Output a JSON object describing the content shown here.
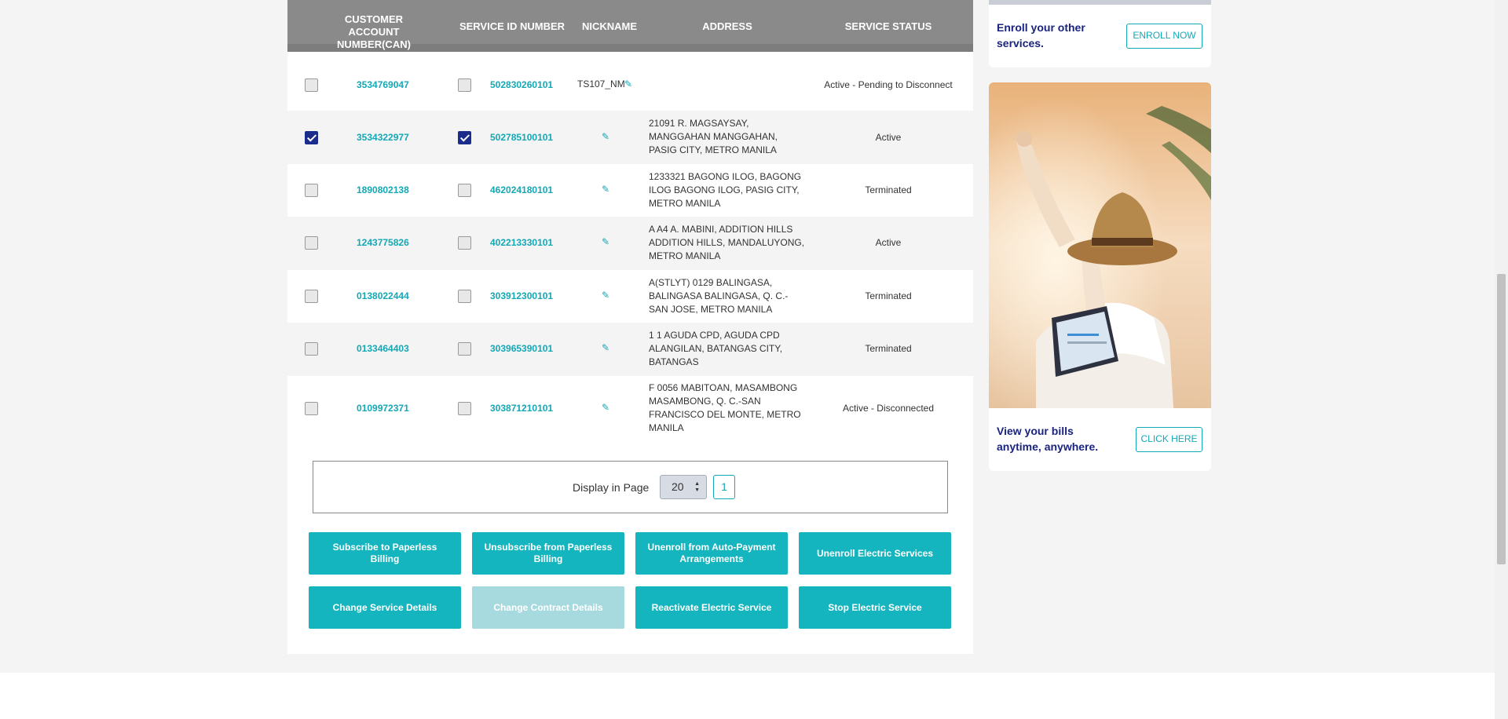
{
  "table": {
    "headers": {
      "can": "CUSTOMER ACCOUNT NUMBER(CAN)",
      "sid": "SERVICE ID NUMBER",
      "nickname": "NICKNAME",
      "address": "ADDRESS",
      "status": "SERVICE STATUS"
    },
    "rows": [
      {
        "can": "3534769047",
        "sid": "502830260101",
        "nickname": "TS107_NM",
        "address": "",
        "status": "Active - Pending to Disconnect",
        "checked": false
      },
      {
        "can": "3534322977",
        "sid": "502785100101",
        "nickname": "",
        "address": "21091 R. MAGSAYSAY, MANGGAHAN MANGGAHAN, PASIG CITY, METRO MANILA",
        "status": "Active",
        "checked": true
      },
      {
        "can": "1890802138",
        "sid": "462024180101",
        "nickname": "",
        "address": "1233321 BAGONG ILOG, BAGONG ILOG BAGONG ILOG, PASIG CITY, METRO MANILA",
        "status": "Terminated",
        "checked": false
      },
      {
        "can": "1243775826",
        "sid": "402213330101",
        "nickname": "",
        "address": "A A4 A. MABINI, ADDITION HILLS ADDITION HILLS, MANDALUYONG, METRO MANILA",
        "status": "Active",
        "checked": false
      },
      {
        "can": "0138022444",
        "sid": "303912300101",
        "nickname": "",
        "address": "A(STLYT) 0129 BALINGASA, BALINGASA BALINGASA, Q. C.-SAN JOSE, METRO MANILA",
        "status": "Terminated",
        "checked": false
      },
      {
        "can": "0133464403",
        "sid": "303965390101",
        "nickname": "",
        "address": "1 1 AGUDA CPD, AGUDA CPD ALANGILAN, BATANGAS CITY, BATANGAS",
        "status": "Terminated",
        "checked": false
      },
      {
        "can": "0109972371",
        "sid": "303871210101",
        "nickname": "",
        "address": "F 0056 MABITOAN, MASAMBONG MASAMBONG, Q. C.-SAN FRANCISCO DEL MONTE, METRO MANILA",
        "status": "Active - Disconnected",
        "checked": false
      }
    ]
  },
  "pager": {
    "label": "Display in Page",
    "page_size": "20",
    "current_page": "1"
  },
  "actions": [
    {
      "label": "Subscribe to Paperless Billing",
      "disabled": false
    },
    {
      "label": "Unsubscribe from Paperless Billing",
      "disabled": false
    },
    {
      "label": "Unenroll from Auto-Payment Arrangements",
      "disabled": false
    },
    {
      "label": "Unenroll Electric Services",
      "disabled": false
    },
    {
      "label": "Change Service Details",
      "disabled": false
    },
    {
      "label": "Change Contract Details",
      "disabled": true
    },
    {
      "label": "Reactivate Electric Service",
      "disabled": false
    },
    {
      "label": "Stop Electric Service",
      "disabled": false
    }
  ],
  "sidebar": {
    "enroll": {
      "text": "Enroll your other services.",
      "button": "ENROLL NOW"
    },
    "bills": {
      "text": "View your bills anytime, anywhere.",
      "button": "CLICK HERE"
    }
  },
  "icons": {
    "edit": "pencil-icon",
    "stepper": "up-down-arrows-icon"
  },
  "colors": {
    "accent": "#14b5bf",
    "link": "#14a8b5",
    "header_bg": "#8a8a8a",
    "checkbox_checked": "#1a2d8c",
    "promo_text": "#1a237e"
  }
}
